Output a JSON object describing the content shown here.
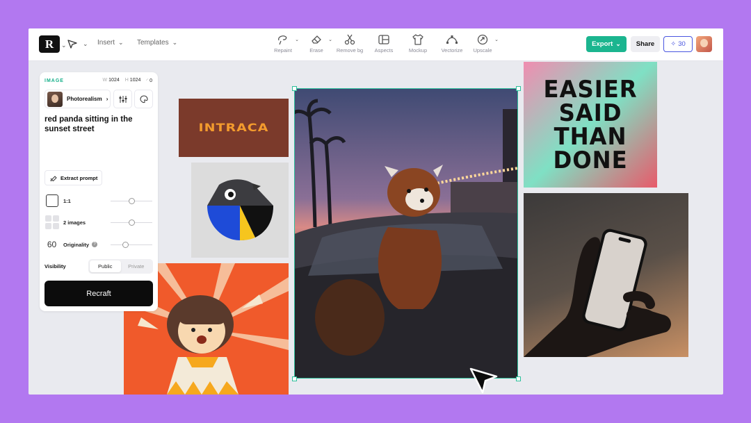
{
  "topbar": {
    "logo_letter": "R",
    "insert_label": "Insert",
    "templates_label": "Templates",
    "tools": [
      {
        "label": "Repaint",
        "icon": "repaint-icon"
      },
      {
        "label": "Erase",
        "icon": "eraser-icon"
      },
      {
        "label": "Remove bg",
        "icon": "scissors-icon"
      },
      {
        "label": "Aspects",
        "icon": "aspects-icon"
      },
      {
        "label": "Mockup",
        "icon": "tshirt-icon"
      },
      {
        "label": "Vectorize",
        "icon": "vectorize-icon"
      },
      {
        "label": "Upscale",
        "icon": "upscale-icon"
      }
    ],
    "export_label": "Export",
    "share_label": "Share",
    "credits": "30"
  },
  "panel": {
    "title": "IMAGE",
    "width_prefix": "W",
    "width": "1024",
    "height_prefix": "H",
    "height": "1024",
    "rotation": "0",
    "style_label": "Photorealism",
    "prompt": "red panda sitting in the sunset street",
    "extract_label": "Extract prompt",
    "ratio_label": "1:1",
    "images_label": "2 images",
    "originality_label": "Originality",
    "originality_icon_text": "60",
    "visibility_label": "Visibility",
    "visibility_options": [
      "Public",
      "Private"
    ],
    "visibility_selected": "Public",
    "recraft_label": "Recraft",
    "ratio_level": 0.5,
    "images_level": 0.5,
    "originality_level": 0.35
  },
  "canvas": {
    "logo_text": "INTRACA",
    "poster_text": "EASIER\nSAID\nTHAN\nDONE"
  },
  "colors": {
    "background": "#b278f0",
    "accent": "#1bb58f",
    "credits": "#4955e0"
  }
}
